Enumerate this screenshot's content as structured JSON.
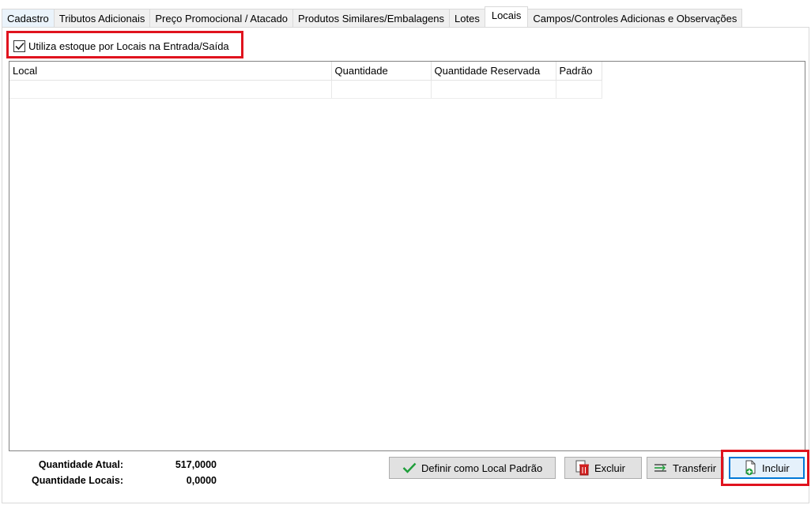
{
  "tabs": [
    {
      "label": "Cadastro"
    },
    {
      "label": "Tributos Adicionais"
    },
    {
      "label": "Preço Promocional / Atacado"
    },
    {
      "label": "Produtos Similares/Embalagens"
    },
    {
      "label": "Lotes"
    },
    {
      "label": "Locais"
    },
    {
      "label": "Campos/Controles Adicionas e Observações"
    }
  ],
  "active_tab": "Locais",
  "checkbox": {
    "label": "Utiliza estoque por Locais na Entrada/Saída",
    "checked": true
  },
  "grid": {
    "columns": [
      "Local",
      "Quantidade",
      "Quantidade Reservada",
      "Padrão"
    ],
    "rows": []
  },
  "summary": {
    "atual_label": "Quantidade Atual:",
    "atual_value": "517,0000",
    "locais_label": "Quantidade Locais:",
    "locais_value": "0,0000"
  },
  "buttons": {
    "definir": "Definir como Local Padrão",
    "excluir": "Excluir",
    "transferir": "Transferir",
    "incluir": "Incluir"
  },
  "colors": {
    "highlight": "#e0131e",
    "focus": "#0078d7",
    "check": "#1e9e3a"
  }
}
